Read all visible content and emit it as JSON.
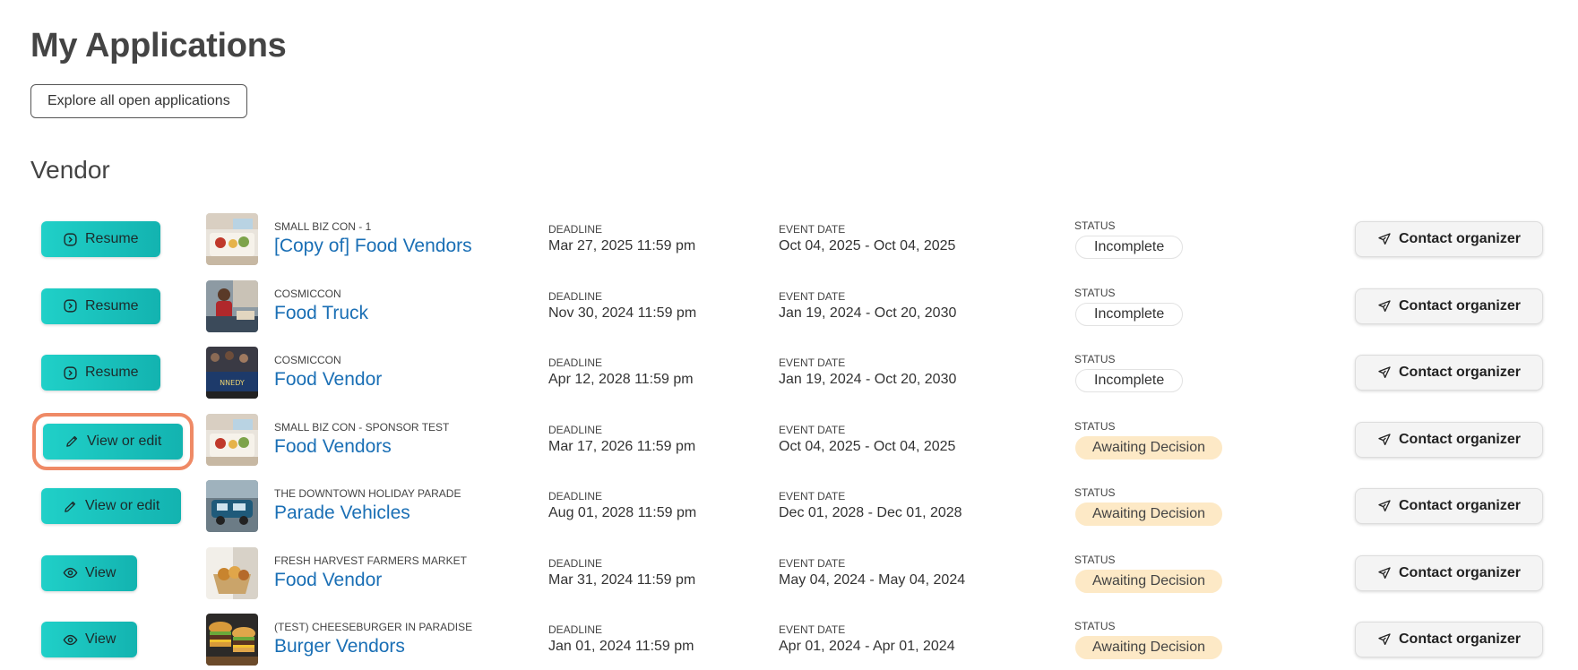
{
  "page": {
    "title": "My Applications",
    "explore_label": "Explore all open applications",
    "section_title": "Vendor"
  },
  "labels": {
    "deadline": "DEADLINE",
    "event_date": "EVENT DATE",
    "status": "STATUS",
    "contact": "Contact organizer"
  },
  "colors": {
    "accent": "#16c1bd",
    "link": "#1a6fb5",
    "awaiting_bg": "#fde9c6",
    "highlight_ring": "#ef8a66"
  },
  "rows": [
    {
      "action": {
        "label": "Resume",
        "icon": "play-circle-icon"
      },
      "org": "SMALL BIZ CON - 1",
      "name": "[Copy of] Food Vendors",
      "deadline": "Mar 27, 2025 11:59 pm",
      "event_date": "Oct 04, 2025 - Oct 04, 2025",
      "status": "Incomplete",
      "thumbnail": "food-vendor-tray-image"
    },
    {
      "action": {
        "label": "Resume",
        "icon": "play-circle-icon"
      },
      "org": "COSMICCON",
      "name": "Food Truck",
      "deadline": "Nov 30, 2024 11:59 pm",
      "event_date": "Jan 19, 2024 - Oct 20, 2030",
      "status": "Incomplete",
      "thumbnail": "food-truck-person-image"
    },
    {
      "action": {
        "label": "Resume",
        "icon": "play-circle-icon"
      },
      "org": "COSMICCON",
      "name": "Food Vendor",
      "deadline": "Apr 12, 2028 11:59 pm",
      "event_date": "Jan 19, 2024 - Oct 20, 2030",
      "status": "Incomplete",
      "thumbnail": "food-stall-crowd-image"
    },
    {
      "action": {
        "label": "View or edit",
        "icon": "pencil-icon",
        "highlighted": true
      },
      "org": "SMALL BIZ CON - SPONSOR TEST",
      "name": "Food Vendors",
      "deadline": "Mar 17, 2026 11:59 pm",
      "event_date": "Oct 04, 2025 - Oct 04, 2025",
      "status": "Awaiting Decision",
      "thumbnail": "food-vendor-tray-image"
    },
    {
      "action": {
        "label": "View or edit",
        "icon": "pencil-icon"
      },
      "org": "THE DOWNTOWN HOLIDAY PARADE",
      "name": "Parade Vehicles",
      "deadline": "Aug 01, 2028 11:59 pm",
      "event_date": "Dec 01, 2028 - Dec 01, 2028",
      "status": "Awaiting Decision",
      "thumbnail": "parade-vehicle-image"
    },
    {
      "action": {
        "label": "View",
        "icon": "eye-icon"
      },
      "org": "FRESH HARVEST FARMERS MARKET",
      "name": "Food Vendor",
      "deadline": "Mar 31, 2024 11:59 pm",
      "event_date": "May 04, 2024 - May 04, 2024",
      "status": "Awaiting Decision",
      "thumbnail": "food-basket-image"
    },
    {
      "action": {
        "label": "View",
        "icon": "eye-icon"
      },
      "org": "(TEST) CHEESEBURGER IN PARADISE",
      "name": "Burger Vendors",
      "deadline": "Jan 01, 2024 11:59 pm",
      "event_date": "Apr 01, 2024 - Apr 01, 2024",
      "status": "Awaiting Decision",
      "thumbnail": "burgers-image"
    }
  ]
}
